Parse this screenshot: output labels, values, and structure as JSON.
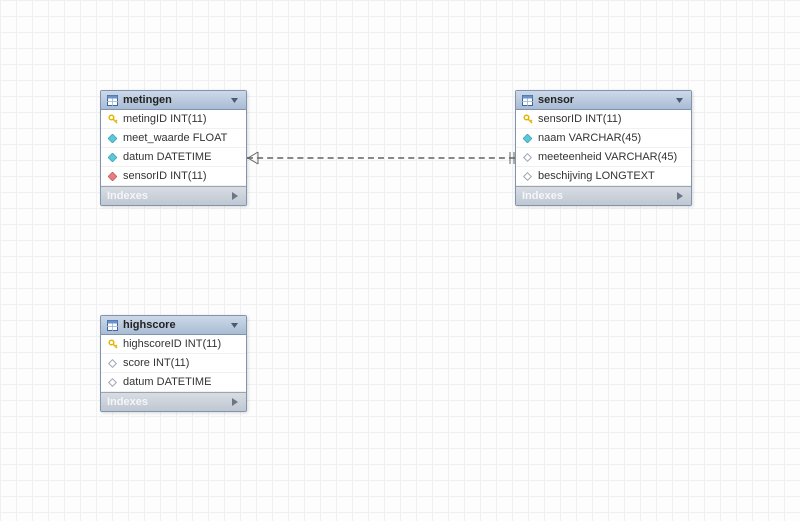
{
  "tables": {
    "metingen": {
      "name": "metingen",
      "indexes_label": "Indexes",
      "cols": [
        {
          "label": "metingID INT(11)"
        },
        {
          "label": "meet_waarde FLOAT"
        },
        {
          "label": "datum DATETIME"
        },
        {
          "label": "sensorID INT(11)"
        }
      ]
    },
    "sensor": {
      "name": "sensor",
      "indexes_label": "Indexes",
      "cols": [
        {
          "label": "sensorID INT(11)"
        },
        {
          "label": "naam VARCHAR(45)"
        },
        {
          "label": "meeteenheid VARCHAR(45)"
        },
        {
          "label": "beschijving LONGTEXT"
        }
      ]
    },
    "highscore": {
      "name": "highscore",
      "indexes_label": "Indexes",
      "cols": [
        {
          "label": "highscoreID INT(11)"
        },
        {
          "label": "score INT(11)"
        },
        {
          "label": "datum DATETIME"
        }
      ]
    }
  }
}
